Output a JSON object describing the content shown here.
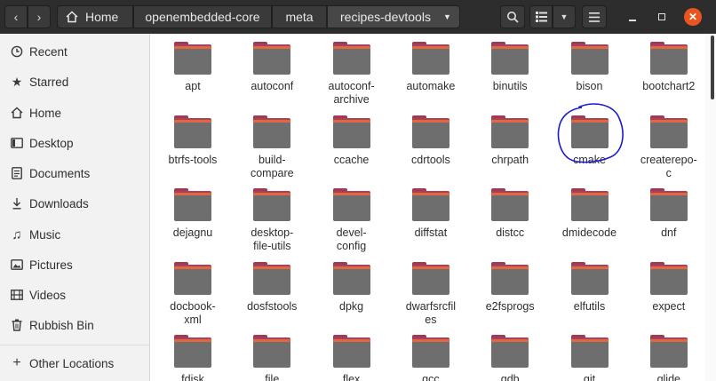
{
  "header": {
    "back_icon": "chevron-left-icon",
    "forward_icon": "chevron-right-icon",
    "breadcrumbs": [
      {
        "label": "Home",
        "icon": "home-icon"
      },
      {
        "label": "openembedded-core"
      },
      {
        "label": "meta"
      },
      {
        "label": "recipes-devtools"
      }
    ],
    "search_icon": "search-icon",
    "view_icon": "list-view-icon",
    "menu_icon": "hamburger-menu-icon",
    "window_controls": [
      "minimize-icon",
      "maximize-icon",
      "close-icon"
    ],
    "close_color": "#e95420"
  },
  "sidebar": {
    "items": [
      {
        "label": "Recent",
        "icon": "clock-icon"
      },
      {
        "label": "Starred",
        "icon": "star-icon"
      },
      {
        "label": "Home",
        "icon": "home-icon"
      },
      {
        "label": "Desktop",
        "icon": "desktop-icon"
      },
      {
        "label": "Documents",
        "icon": "document-icon"
      },
      {
        "label": "Downloads",
        "icon": "download-icon"
      },
      {
        "label": "Music",
        "icon": "music-icon"
      },
      {
        "label": "Pictures",
        "icon": "picture-icon"
      },
      {
        "label": "Videos",
        "icon": "video-icon"
      },
      {
        "label": "Rubbish Bin",
        "icon": "trash-icon"
      }
    ],
    "other_locations": {
      "label": "Other Locations",
      "icon": "plus-icon"
    }
  },
  "folders": [
    [
      "apt"
    ],
    [
      "autoconf"
    ],
    [
      "autoconf-",
      "archive"
    ],
    [
      "automake"
    ],
    [
      "binutils"
    ],
    [
      "bison"
    ],
    [
      "bootchart2"
    ],
    [
      "btrfs-tools"
    ],
    [
      "build-",
      "compare"
    ],
    [
      "ccache"
    ],
    [
      "cdrtools"
    ],
    [
      "chrpath"
    ],
    [
      "cmake"
    ],
    [
      "createrepo-",
      "c"
    ],
    [
      "dejagnu"
    ],
    [
      "desktop-",
      "file-utils"
    ],
    [
      "devel-",
      "config"
    ],
    [
      "diffstat"
    ],
    [
      "distcc"
    ],
    [
      "dmidecode"
    ],
    [
      "dnf"
    ],
    [
      "docbook-",
      "xml"
    ],
    [
      "dosfstools"
    ],
    [
      "dpkg"
    ],
    [
      "dwarfsrcfil",
      "es"
    ],
    [
      "e2fsprogs"
    ],
    [
      "elfutils"
    ],
    [
      "expect"
    ],
    [
      "fdisk"
    ],
    [
      "file"
    ],
    [
      "flex"
    ],
    [
      "gcc"
    ],
    [
      "gdb"
    ],
    [
      "git"
    ],
    [
      "glide"
    ]
  ],
  "annotation": {
    "target": "cmake",
    "color": "#1a1acc"
  }
}
